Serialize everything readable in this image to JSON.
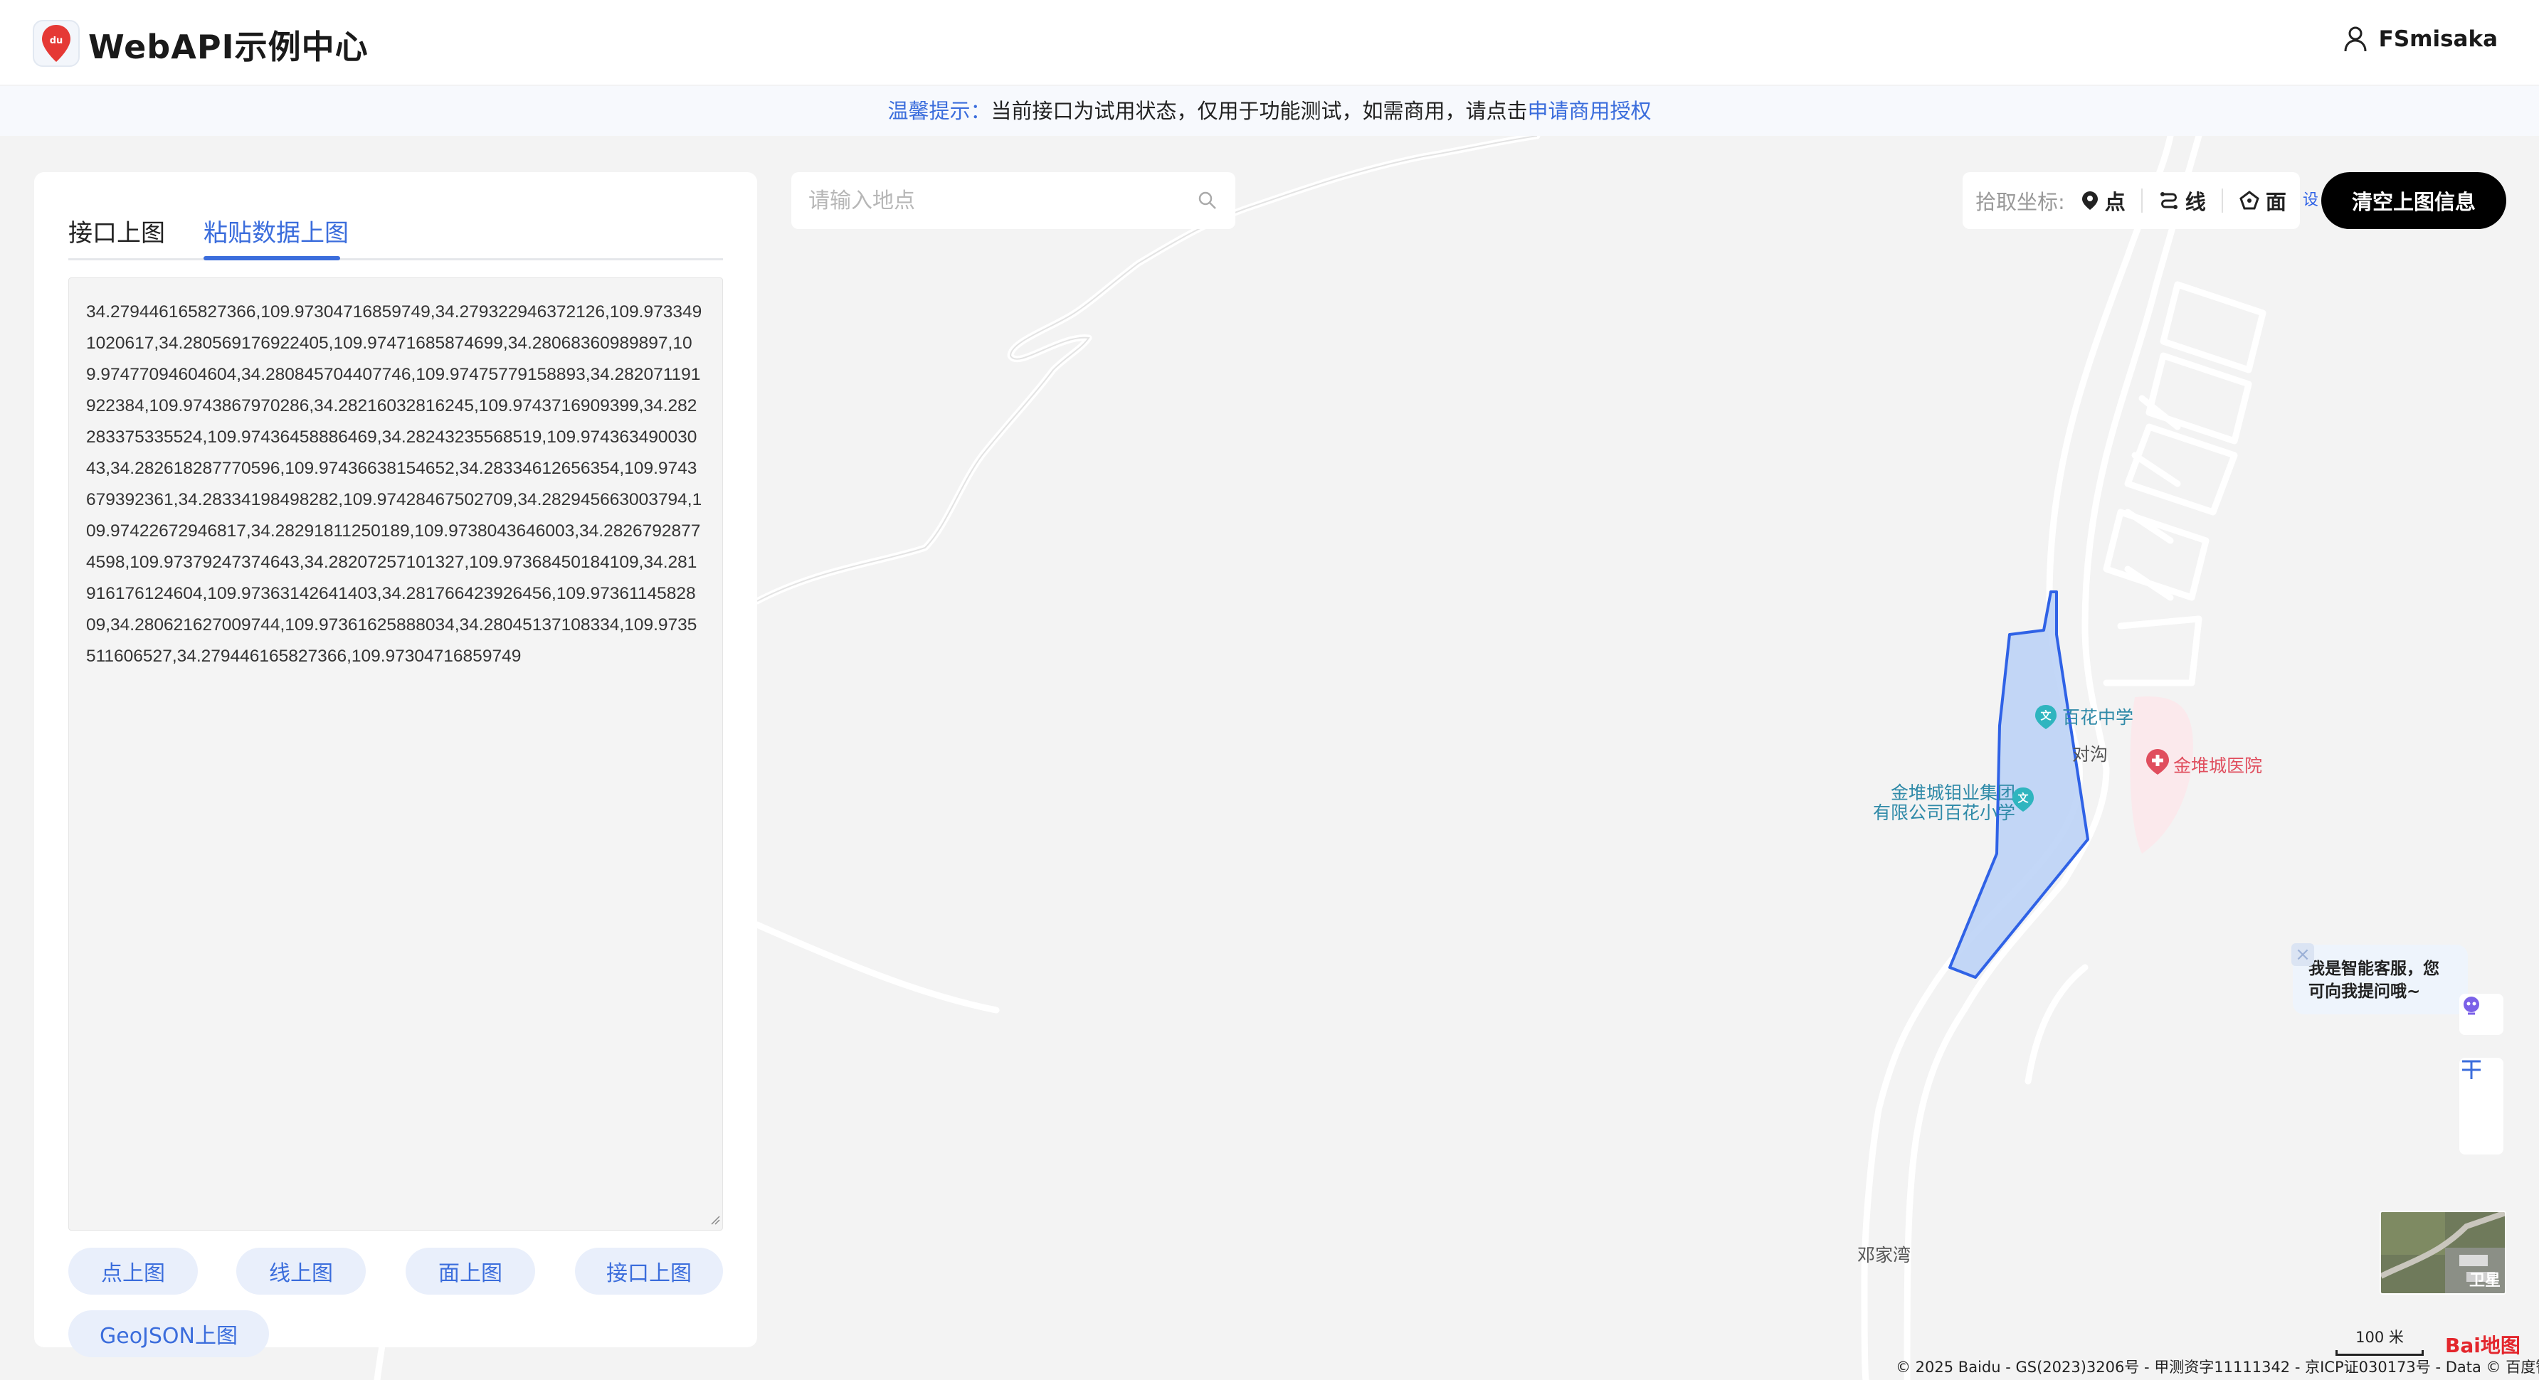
{
  "header": {
    "app_title": "WebAPI示例中心",
    "user_name": "FSmisaka"
  },
  "notice": {
    "tip": "温馨提示：",
    "message": "当前接口为试用状态，仅用于功能测试，如需商用，请点击",
    "link": "申请商用授权"
  },
  "panel": {
    "tabs": [
      {
        "label": "接口上图",
        "active": false
      },
      {
        "label": "粘贴数据上图",
        "active": true
      }
    ],
    "textarea_value": "34.279446165827366,109.97304716859749,34.279322946372126,109.9733491020617,34.280569176922405,109.97471685874699,34.28068360989897,109.97477094604604,34.280845704407746,109.97475779158893,34.282071191922384,109.9743867970286,34.28216032816245,109.9743716909399,34.282283375335524,109.97436458886469,34.28243235568519,109.97436349003043,34.282618287770596,109.97436638154652,34.28334612656354,109.9743679392361,34.28334198498282,109.97428467502709,34.282945663003794,109.97422672946817,34.28291811250189,109.9738043646003,34.28267928774598,109.97379247374643,34.28207257101327,109.97368450184109,34.281916176124604,109.97363142641403,34.281766423926456,109.9736114582809,34.280621627009744,109.97361625888034,34.28045137108334,109.9735511606527,34.279446165827366,109.97304716859749",
    "buttons": {
      "point": "点上图",
      "line": "线上图",
      "polygon": "面上图",
      "api": "接口上图",
      "geojson": "GeoJSON上图"
    }
  },
  "search": {
    "placeholder": "请输入地点"
  },
  "picker": {
    "label": "拾取坐标:",
    "point": "点",
    "line": "线",
    "polygon": "面"
  },
  "clear_button": "清空上图信息",
  "map": {
    "labels": {
      "school_middle": "百花中学",
      "hospital": "金堆城医院",
      "duigou": "对沟",
      "company_line1": "金堆城钼业集团",
      "company_line2": "有限公司百花小学",
      "dengjiawan": "邓家湾",
      "edge_text": "设"
    },
    "chat": "我是智能客服，您可向我提问哦~",
    "thumbnail_label": "卫星",
    "scale_label": "100 米",
    "copyright": "© 2025 Baidu - GS(2023)3206号 - 甲测资字11111342 - 京ICP证030173号 - Data © 百度智图",
    "logo_text": "Bai地图"
  },
  "colors": {
    "accent": "#3b6ddc",
    "polygon_fill": "#bcd3f6",
    "polygon_stroke": "#2f62e6",
    "hospital": "#e04e5e",
    "school": "#2fb5bf"
  }
}
